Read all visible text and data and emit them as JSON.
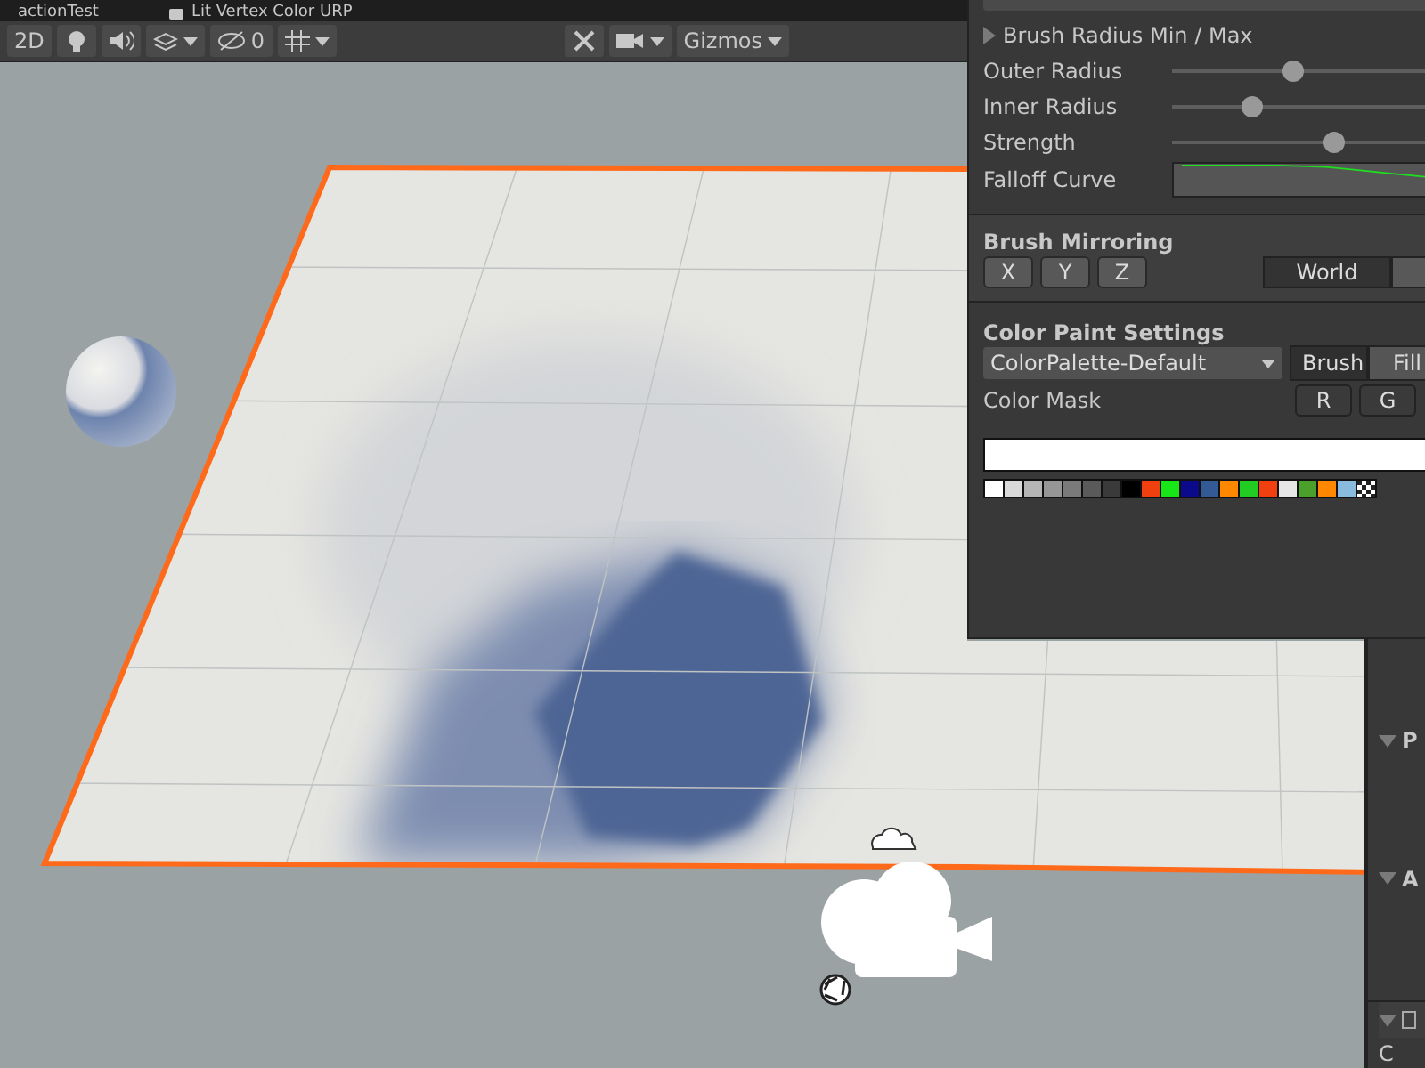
{
  "tabs": [
    {
      "label": "actionTest"
    },
    {
      "label": "Lit Vertex Color URP"
    }
  ],
  "toolbar": {
    "mode_2d": "2D",
    "hidden_count": "0",
    "gizmos": "Gizmos"
  },
  "brush_panel": {
    "radius_foldout": {
      "label": "Brush Radius Min / Max",
      "expanded": false
    },
    "sliders": [
      {
        "label": "Outer Radius",
        "level": 0.44
      },
      {
        "label": "Inner Radius",
        "level": 0.29
      },
      {
        "label": "Strength",
        "level": 0.59
      }
    ],
    "falloff": {
      "label": "Falloff Curve"
    },
    "mirroring": {
      "title": "Brush Mirroring",
      "axes": [
        {
          "label": "X",
          "selected": false
        },
        {
          "label": "Y",
          "selected": false
        },
        {
          "label": "Z",
          "selected": false
        }
      ],
      "spaces": [
        {
          "label": "World",
          "selected": false
        },
        {
          "selected": true
        }
      ]
    },
    "color_paint": {
      "title": "Color Paint Settings",
      "palette": "ColorPalette-Default",
      "modes": [
        {
          "label": "Brush",
          "selected": false
        },
        {
          "label": "Fill",
          "selected": true
        }
      ],
      "mask_label": "Color Mask",
      "channels": [
        {
          "label": "R"
        },
        {
          "label": "G"
        }
      ],
      "swatches": [
        {
          "color": "#ffffff"
        },
        {
          "color": "#d9d9d9"
        },
        {
          "color": "#b5b5b5"
        },
        {
          "color": "#969696"
        },
        {
          "color": "#7a7a7a"
        },
        {
          "color": "#5a5a5a"
        },
        {
          "color": "#3a3a3a"
        },
        {
          "color": "#000000"
        },
        {
          "color": "#f04010"
        },
        {
          "color": "#19e619"
        },
        {
          "color": "#0a0a8a"
        },
        {
          "color": "#345a96"
        },
        {
          "color": "#ff8800"
        },
        {
          "color": "#22cc22"
        },
        {
          "color": "#f04010"
        },
        {
          "color": "#e6e6e6"
        },
        {
          "color": "#4aa02a"
        },
        {
          "color": "#ff8800"
        },
        {
          "color": "#88bbdd"
        }
      ]
    }
  },
  "inspector": {
    "sections": [
      {
        "label": "P"
      },
      {
        "label": "A"
      }
    ],
    "footer": "C"
  }
}
